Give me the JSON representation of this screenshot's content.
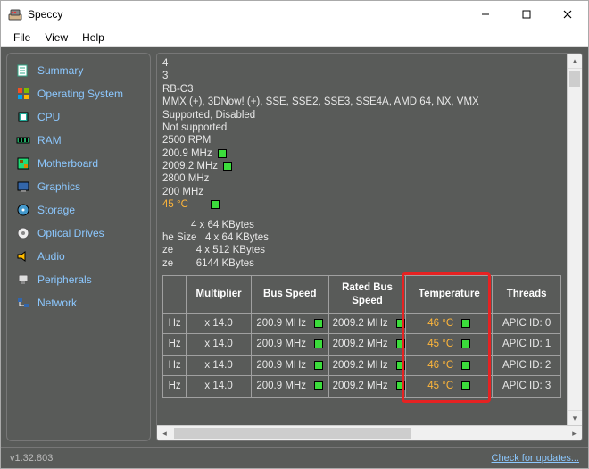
{
  "window": {
    "title": "Speccy"
  },
  "menu": {
    "file": "File",
    "view": "View",
    "help": "Help"
  },
  "sidebar": {
    "items": [
      {
        "label": "Summary",
        "color": "#8cc8ff"
      },
      {
        "label": "Operating System",
        "color": "#8cc8ff"
      },
      {
        "label": "CPU",
        "color": "#8cc8ff"
      },
      {
        "label": "RAM",
        "color": "#8cc8ff"
      },
      {
        "label": "Motherboard",
        "color": "#8cc8ff"
      },
      {
        "label": "Graphics",
        "color": "#8cc8ff"
      },
      {
        "label": "Storage",
        "color": "#8cc8ff"
      },
      {
        "label": "Optical Drives",
        "color": "#8cc8ff"
      },
      {
        "label": "Audio",
        "color": "#8cc8ff"
      },
      {
        "label": "Peripherals",
        "color": "#8cc8ff"
      },
      {
        "label": "Network",
        "color": "#8cc8ff"
      }
    ]
  },
  "info": {
    "lines": [
      "4",
      "3",
      "RB-C3",
      "MMX (+), 3DNow! (+), SSE, SSE2, SSE3, SSE4A, AMD 64, NX, VMX",
      "Supported, Disabled",
      "Not supported",
      "2500 RPM"
    ],
    "clock1": "200.9 MHz",
    "clock2": "2009.2 MHz",
    "clock3": "2800 MHz",
    "clock4": "200 MHz",
    "temp": "45 °C",
    "cache_label_1": "          4 x 64 KBytes",
    "cache_label_2": "he Size   4 x 64 KBytes",
    "cache_label_3": "ze        4 x 512 KBytes",
    "cache_label_4": "ze        6144 KBytes"
  },
  "table": {
    "headers": {
      "col0": "",
      "multiplier": "Multiplier",
      "bus_speed": "Bus Speed",
      "rated_bus_speed": "Rated Bus Speed",
      "temperature": "Temperature",
      "threads": "Threads"
    },
    "rows": [
      {
        "hz": "Hz",
        "mult": "x 14.0",
        "bus": "200.9 MHz",
        "rated": "2009.2 MHz",
        "temp": "46 °C",
        "threads": "APIC ID: 0"
      },
      {
        "hz": "Hz",
        "mult": "x 14.0",
        "bus": "200.9 MHz",
        "rated": "2009.2 MHz",
        "temp": "45 °C",
        "threads": "APIC ID: 1"
      },
      {
        "hz": "Hz",
        "mult": "x 14.0",
        "bus": "200.9 MHz",
        "rated": "2009.2 MHz",
        "temp": "46 °C",
        "threads": "APIC ID: 2"
      },
      {
        "hz": "Hz",
        "mult": "x 14.0",
        "bus": "200.9 MHz",
        "rated": "2009.2 MHz",
        "temp": "45 °C",
        "threads": "APIC ID: 3"
      }
    ]
  },
  "status": {
    "version": "v1.32.803",
    "updates": "Check for updates..."
  }
}
